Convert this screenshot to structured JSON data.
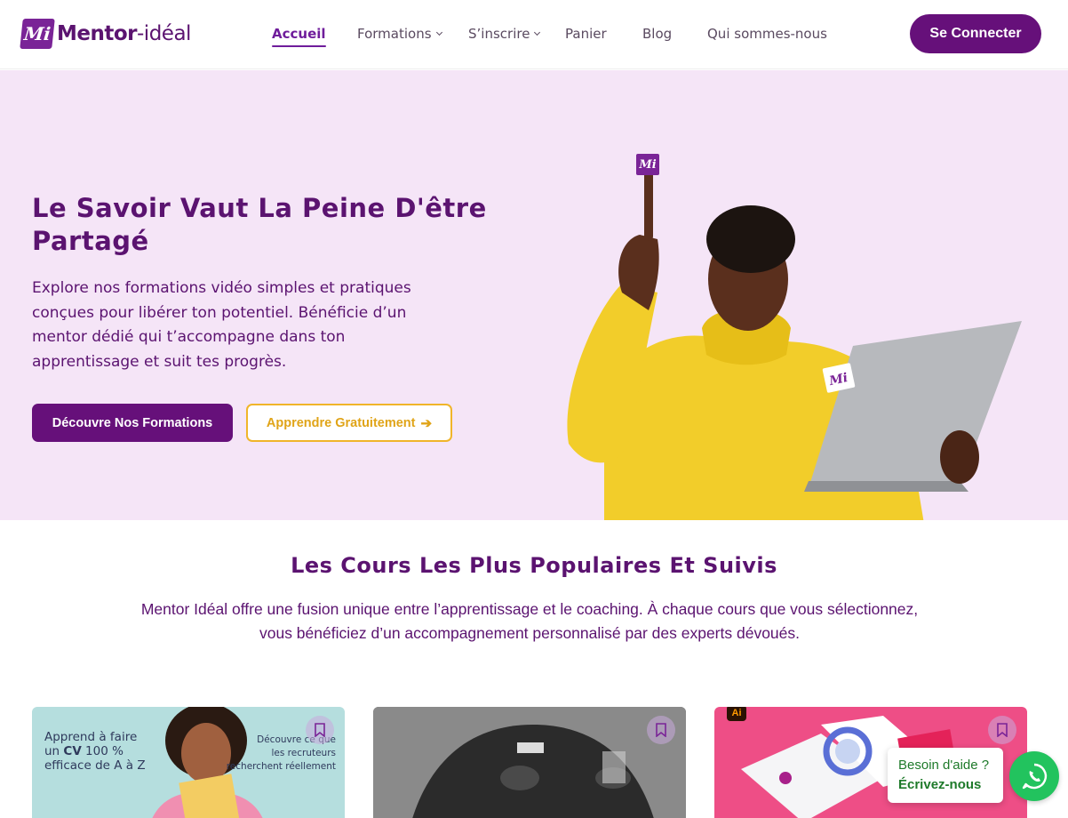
{
  "header": {
    "logo_mark": "Mi",
    "logo_name": "Mentor",
    "logo_suffix": "-idéal",
    "nav": [
      {
        "label": "Accueil",
        "active": true
      },
      {
        "label": "Formations",
        "dropdown": true
      },
      {
        "label": "S’inscrire",
        "dropdown": true
      },
      {
        "label": "Panier"
      },
      {
        "label": "Blog"
      },
      {
        "label": "Qui sommes-nous"
      }
    ],
    "login_label": "Se Connecter"
  },
  "hero": {
    "title": "Le Savoir Vaut La Peine D'être Partagé",
    "text": "Explore nos formations vidéo simples et pratiques conçues pour libérer ton potentiel. Bénéficie d’un mentor dédié qui t’accompagne dans ton apprentissage et suit tes progrès.",
    "primary_button": "Découvre Nos Formations",
    "secondary_button": "Apprendre Gratuitement",
    "illustration_logo": "Mi"
  },
  "courses": {
    "title": "Les Cours Les Plus Populaires Et Suivis",
    "subtitle": "Mentor Idéal offre une fusion unique entre l’apprentissage et le coaching. À chaque cours que vous sélectionnez, vous bénéficiez d’un accompagnement personnalisé par des experts dévoués.",
    "cards": [
      {
        "line1": "Apprend à faire",
        "line2_pre": "un ",
        "line2_bold": "CV",
        "line2_post": " 100 %",
        "line3": "efficace de A à Z",
        "side_text1": "Découvre ce que",
        "side_text2": "les recruteurs",
        "side_text3": "recherchent réellement"
      },
      {},
      {
        "badge": "Ai"
      }
    ]
  },
  "help": {
    "question": "Besoin d'aide ?",
    "action": "Écrivez-nous"
  },
  "colors": {
    "brand_purple": "#66107a",
    "hero_bg": "#f5e5f7",
    "accent_yellow": "#f0b52a",
    "whatsapp_green": "#22c35e"
  }
}
